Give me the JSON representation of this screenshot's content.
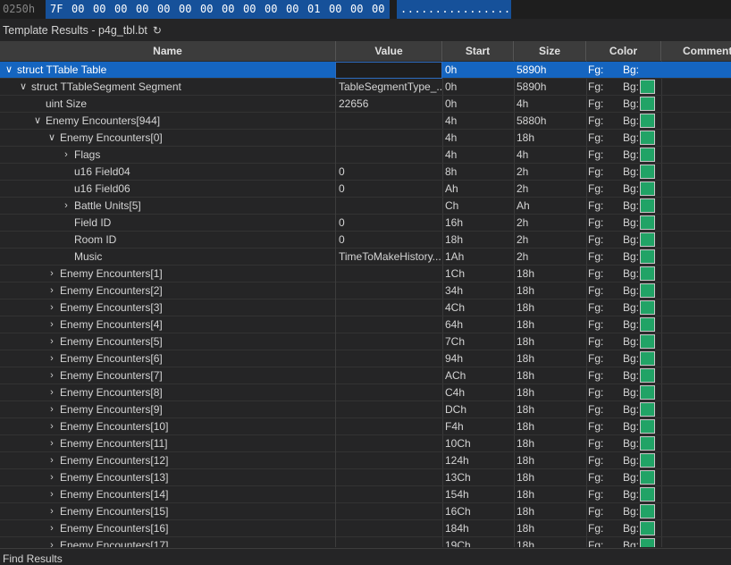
{
  "hex_row": {
    "offset": "0250h",
    "bytes": [
      "7F",
      "00",
      "00",
      "00",
      "00",
      "00",
      "00",
      "00",
      "00",
      "00",
      "00",
      "00",
      "01",
      "00",
      "00",
      "00"
    ],
    "ascii": "................"
  },
  "panel": {
    "title": "Template Results - p4g_tbl.bt",
    "refresh_icon": "refresh-icon"
  },
  "columns": {
    "name": "Name",
    "value": "Value",
    "start": "Start",
    "size": "Size",
    "color": "Color",
    "comment": "Comment"
  },
  "rows": [
    {
      "name": "struct TTable Table",
      "value": "",
      "start": "0h",
      "size": "5890h",
      "fg": "Fg:",
      "bg": "Bg:",
      "level": 0,
      "expander": "expanded",
      "selected": true,
      "swatch": false
    },
    {
      "name": "struct TTableSegment Segment",
      "value": "TableSegmentType_...",
      "start": "0h",
      "size": "5890h",
      "fg": "Fg:",
      "bg": "Bg:",
      "level": 1,
      "expander": "expanded",
      "selected": false,
      "swatch": true
    },
    {
      "name": "uint Size",
      "value": "22656",
      "start": "0h",
      "size": "4h",
      "fg": "Fg:",
      "bg": "Bg:",
      "level": 2,
      "expander": "none",
      "selected": false,
      "swatch": true
    },
    {
      "name": "Enemy Encounters[944]",
      "value": "",
      "start": "4h",
      "size": "5880h",
      "fg": "Fg:",
      "bg": "Bg:",
      "level": 2,
      "expander": "expanded",
      "selected": false,
      "swatch": true
    },
    {
      "name": "Enemy Encounters[0]",
      "value": "",
      "start": "4h",
      "size": "18h",
      "fg": "Fg:",
      "bg": "Bg:",
      "level": 3,
      "expander": "expanded",
      "selected": false,
      "swatch": true
    },
    {
      "name": "Flags",
      "value": "",
      "start": "4h",
      "size": "4h",
      "fg": "Fg:",
      "bg": "Bg:",
      "level": 4,
      "expander": "collapsed",
      "selected": false,
      "swatch": true
    },
    {
      "name": "u16 Field04",
      "value": "0",
      "start": "8h",
      "size": "2h",
      "fg": "Fg:",
      "bg": "Bg:",
      "level": 4,
      "expander": "none",
      "selected": false,
      "swatch": true
    },
    {
      "name": "u16 Field06",
      "value": "0",
      "start": "Ah",
      "size": "2h",
      "fg": "Fg:",
      "bg": "Bg:",
      "level": 4,
      "expander": "none",
      "selected": false,
      "swatch": true
    },
    {
      "name": "Battle Units[5]",
      "value": "",
      "start": "Ch",
      "size": "Ah",
      "fg": "Fg:",
      "bg": "Bg:",
      "level": 4,
      "expander": "collapsed",
      "selected": false,
      "swatch": true
    },
    {
      "name": "Field ID",
      "value": "0",
      "start": "16h",
      "size": "2h",
      "fg": "Fg:",
      "bg": "Bg:",
      "level": 4,
      "expander": "none",
      "selected": false,
      "swatch": true
    },
    {
      "name": "Room ID",
      "value": "0",
      "start": "18h",
      "size": "2h",
      "fg": "Fg:",
      "bg": "Bg:",
      "level": 4,
      "expander": "none",
      "selected": false,
      "swatch": true
    },
    {
      "name": "Music",
      "value": "TimeToMakeHistory...",
      "start": "1Ah",
      "size": "2h",
      "fg": "Fg:",
      "bg": "Bg:",
      "level": 4,
      "expander": "none",
      "selected": false,
      "swatch": true
    },
    {
      "name": "Enemy Encounters[1]",
      "value": "",
      "start": "1Ch",
      "size": "18h",
      "fg": "Fg:",
      "bg": "Bg:",
      "level": 3,
      "expander": "collapsed",
      "selected": false,
      "swatch": true
    },
    {
      "name": "Enemy Encounters[2]",
      "value": "",
      "start": "34h",
      "size": "18h",
      "fg": "Fg:",
      "bg": "Bg:",
      "level": 3,
      "expander": "collapsed",
      "selected": false,
      "swatch": true
    },
    {
      "name": "Enemy Encounters[3]",
      "value": "",
      "start": "4Ch",
      "size": "18h",
      "fg": "Fg:",
      "bg": "Bg:",
      "level": 3,
      "expander": "collapsed",
      "selected": false,
      "swatch": true
    },
    {
      "name": "Enemy Encounters[4]",
      "value": "",
      "start": "64h",
      "size": "18h",
      "fg": "Fg:",
      "bg": "Bg:",
      "level": 3,
      "expander": "collapsed",
      "selected": false,
      "swatch": true
    },
    {
      "name": "Enemy Encounters[5]",
      "value": "",
      "start": "7Ch",
      "size": "18h",
      "fg": "Fg:",
      "bg": "Bg:",
      "level": 3,
      "expander": "collapsed",
      "selected": false,
      "swatch": true
    },
    {
      "name": "Enemy Encounters[6]",
      "value": "",
      "start": "94h",
      "size": "18h",
      "fg": "Fg:",
      "bg": "Bg:",
      "level": 3,
      "expander": "collapsed",
      "selected": false,
      "swatch": true
    },
    {
      "name": "Enemy Encounters[7]",
      "value": "",
      "start": "ACh",
      "size": "18h",
      "fg": "Fg:",
      "bg": "Bg:",
      "level": 3,
      "expander": "collapsed",
      "selected": false,
      "swatch": true
    },
    {
      "name": "Enemy Encounters[8]",
      "value": "",
      "start": "C4h",
      "size": "18h",
      "fg": "Fg:",
      "bg": "Bg:",
      "level": 3,
      "expander": "collapsed",
      "selected": false,
      "swatch": true
    },
    {
      "name": "Enemy Encounters[9]",
      "value": "",
      "start": "DCh",
      "size": "18h",
      "fg": "Fg:",
      "bg": "Bg:",
      "level": 3,
      "expander": "collapsed",
      "selected": false,
      "swatch": true
    },
    {
      "name": "Enemy Encounters[10]",
      "value": "",
      "start": "F4h",
      "size": "18h",
      "fg": "Fg:",
      "bg": "Bg:",
      "level": 3,
      "expander": "collapsed",
      "selected": false,
      "swatch": true
    },
    {
      "name": "Enemy Encounters[11]",
      "value": "",
      "start": "10Ch",
      "size": "18h",
      "fg": "Fg:",
      "bg": "Bg:",
      "level": 3,
      "expander": "collapsed",
      "selected": false,
      "swatch": true
    },
    {
      "name": "Enemy Encounters[12]",
      "value": "",
      "start": "124h",
      "size": "18h",
      "fg": "Fg:",
      "bg": "Bg:",
      "level": 3,
      "expander": "collapsed",
      "selected": false,
      "swatch": true
    },
    {
      "name": "Enemy Encounters[13]",
      "value": "",
      "start": "13Ch",
      "size": "18h",
      "fg": "Fg:",
      "bg": "Bg:",
      "level": 3,
      "expander": "collapsed",
      "selected": false,
      "swatch": true
    },
    {
      "name": "Enemy Encounters[14]",
      "value": "",
      "start": "154h",
      "size": "18h",
      "fg": "Fg:",
      "bg": "Bg:",
      "level": 3,
      "expander": "collapsed",
      "selected": false,
      "swatch": true
    },
    {
      "name": "Enemy Encounters[15]",
      "value": "",
      "start": "16Ch",
      "size": "18h",
      "fg": "Fg:",
      "bg": "Bg:",
      "level": 3,
      "expander": "collapsed",
      "selected": false,
      "swatch": true
    },
    {
      "name": "Enemy Encounters[16]",
      "value": "",
      "start": "184h",
      "size": "18h",
      "fg": "Fg:",
      "bg": "Bg:",
      "level": 3,
      "expander": "collapsed",
      "selected": false,
      "swatch": true
    },
    {
      "name": "Enemy Encounters[17]",
      "value": "",
      "start": "19Ch",
      "size": "18h",
      "fg": "Fg:",
      "bg": "Bg:",
      "level": 3,
      "expander": "collapsed",
      "selected": false,
      "swatch": true
    }
  ],
  "find_results": {
    "label": "Find Results"
  },
  "colors": {
    "selected_row": "#1565c0",
    "swatch": "#21a366",
    "hex_highlight": "#16519a"
  }
}
